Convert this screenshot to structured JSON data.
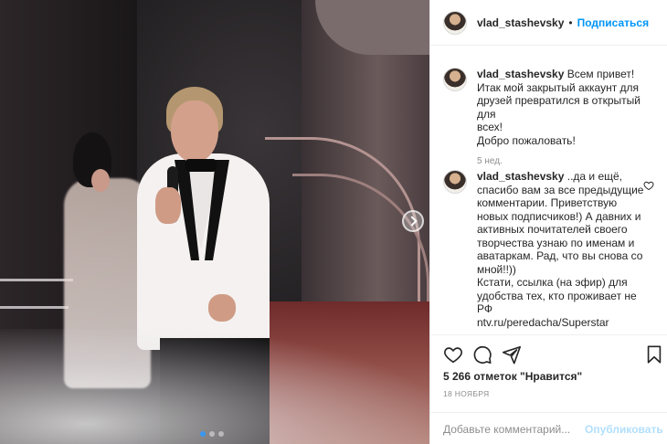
{
  "post": {
    "username": "vlad_stashevsky",
    "separator": "•",
    "follow_label": "Подписаться",
    "carousel": {
      "slides": 3,
      "active_index": 0
    }
  },
  "comments": [
    {
      "author": "vlad_stashevsky",
      "lines": [
        "Всем привет!",
        "Итак мой закрытый аккаунт для",
        "друзей превратился в открытый для",
        "всех!",
        "Добро пожаловать!"
      ],
      "time": "5 нед."
    },
    {
      "author": "vlad_stashevsky",
      "lines": [
        "..да и ещё,",
        "спасибо вам за все предыдущие",
        "комментарии. Приветствую",
        "новых подписчиков!) А давних и",
        "активных почитателей своего",
        "творчества узнаю по именам и",
        "аватаркам. Рад, что вы снова со",
        "мной!!))",
        "Кстати, ссылка (на эфир) для",
        "удобства тех, кто проживает не",
        "РФ",
        "ntv.ru/peredacha/Superstar"
      ]
    }
  ],
  "actions": {
    "like_icon": "heart-icon",
    "comment_icon": "comment-icon",
    "share_icon": "paper-plane-icon",
    "save_icon": "bookmark-icon"
  },
  "likes_text": "5 266 отметок \"Нравится\"",
  "date_text": "18 НОЯБРЯ",
  "comment_input": {
    "placeholder": "Добавьте комментарий...",
    "value": ""
  },
  "post_button_label": "Опубликовать",
  "colors": {
    "accent": "#0095f6",
    "post_disabled": "#b2dffc",
    "secondary_text": "#8e8e8e"
  }
}
